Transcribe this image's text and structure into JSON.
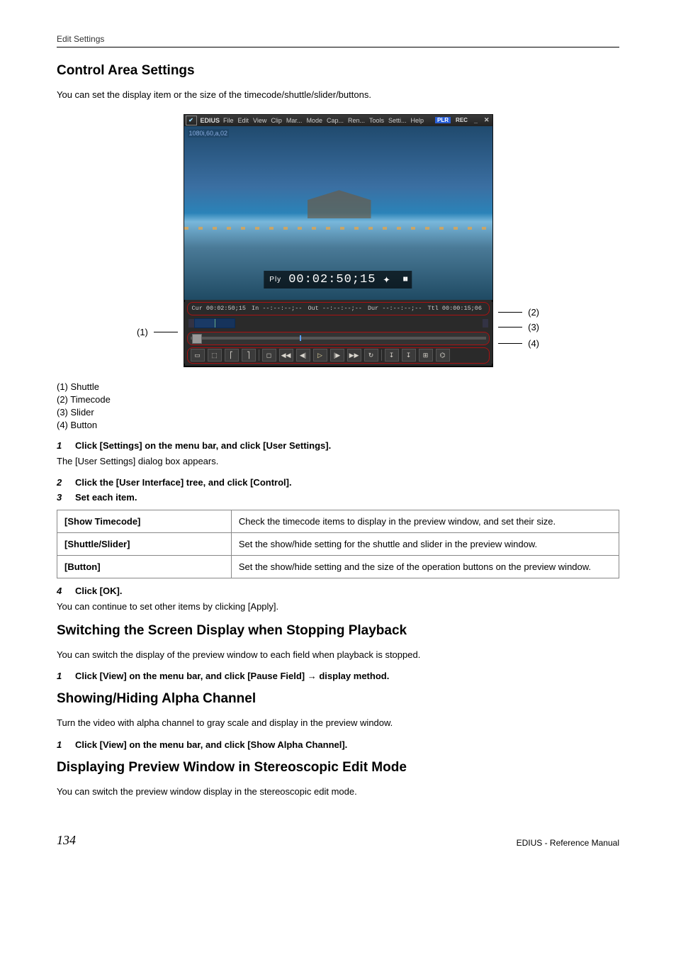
{
  "header": {
    "section": "Edit Settings"
  },
  "section1": {
    "title": "Control Area Settings",
    "intro": "You can set the display item or the size of the timecode/shuttle/slider/buttons."
  },
  "figure": {
    "app_name": "EDIUS",
    "menu": [
      "File",
      "Edit",
      "View",
      "Clip",
      "Mar...",
      "Mode",
      "Cap...",
      "Ren...",
      "Tools",
      "Setti...",
      "Help"
    ],
    "plr": "PLR",
    "rec": "REC",
    "clip_name": "1080i,60,a,02",
    "tc_label": "Ply",
    "tc_value": "00:02:50;15",
    "tc_row": {
      "cur": "Cur 00:02:50;15",
      "in": "In --:--:--;--",
      "out": "Out --:--:--;--",
      "dur": "Dur --:--:--;--",
      "ttl": "Ttl 00:00:15;06"
    },
    "callouts": {
      "c1": "(1)",
      "c2": "(2)",
      "c3": "(3)",
      "c4": "(4)"
    },
    "legend": [
      "(1) Shuttle",
      "(2) Timecode",
      "(3) Slider",
      "(4) Button"
    ]
  },
  "steps_a": [
    {
      "n": "1",
      "t": "Click [Settings] on the menu bar, and click [User Settings]."
    }
  ],
  "note_a": "The [User Settings] dialog box appears.",
  "steps_b": [
    {
      "n": "2",
      "t": "Click the [User Interface] tree, and click [Control]."
    },
    {
      "n": "3",
      "t": "Set each item."
    }
  ],
  "table": [
    {
      "k": "[Show Timecode]",
      "v": "Check the timecode items to display in the preview window, and set their size."
    },
    {
      "k": "[Shuttle/Slider]",
      "v": "Set the show/hide setting for the shuttle and slider in the preview window."
    },
    {
      "k": "[Button]",
      "v": "Set the show/hide setting and the size of the operation buttons on the preview window."
    }
  ],
  "steps_c": [
    {
      "n": "4",
      "t": "Click [OK]."
    }
  ],
  "note_c": "You can continue to set other items by clicking [Apply].",
  "section2": {
    "title": "Switching the Screen Display when Stopping Playback",
    "intro": "You can switch the display of the preview window to each field when playback is stopped.",
    "step": {
      "n": "1",
      "t": "Click [View] on the menu bar, and click [Pause Field] → display method."
    }
  },
  "section3": {
    "title": "Showing/Hiding Alpha Channel",
    "intro": "Turn the video with alpha channel to gray scale and display in the preview window.",
    "step": {
      "n": "1",
      "t": "Click [View] on the menu bar, and click [Show Alpha Channel]."
    }
  },
  "section4": {
    "title": "Displaying Preview Window in Stereoscopic Edit Mode",
    "intro": "You can switch the preview window display in the stereoscopic edit mode."
  },
  "footer": {
    "page": "134",
    "doc": "EDIUS - Reference Manual"
  }
}
